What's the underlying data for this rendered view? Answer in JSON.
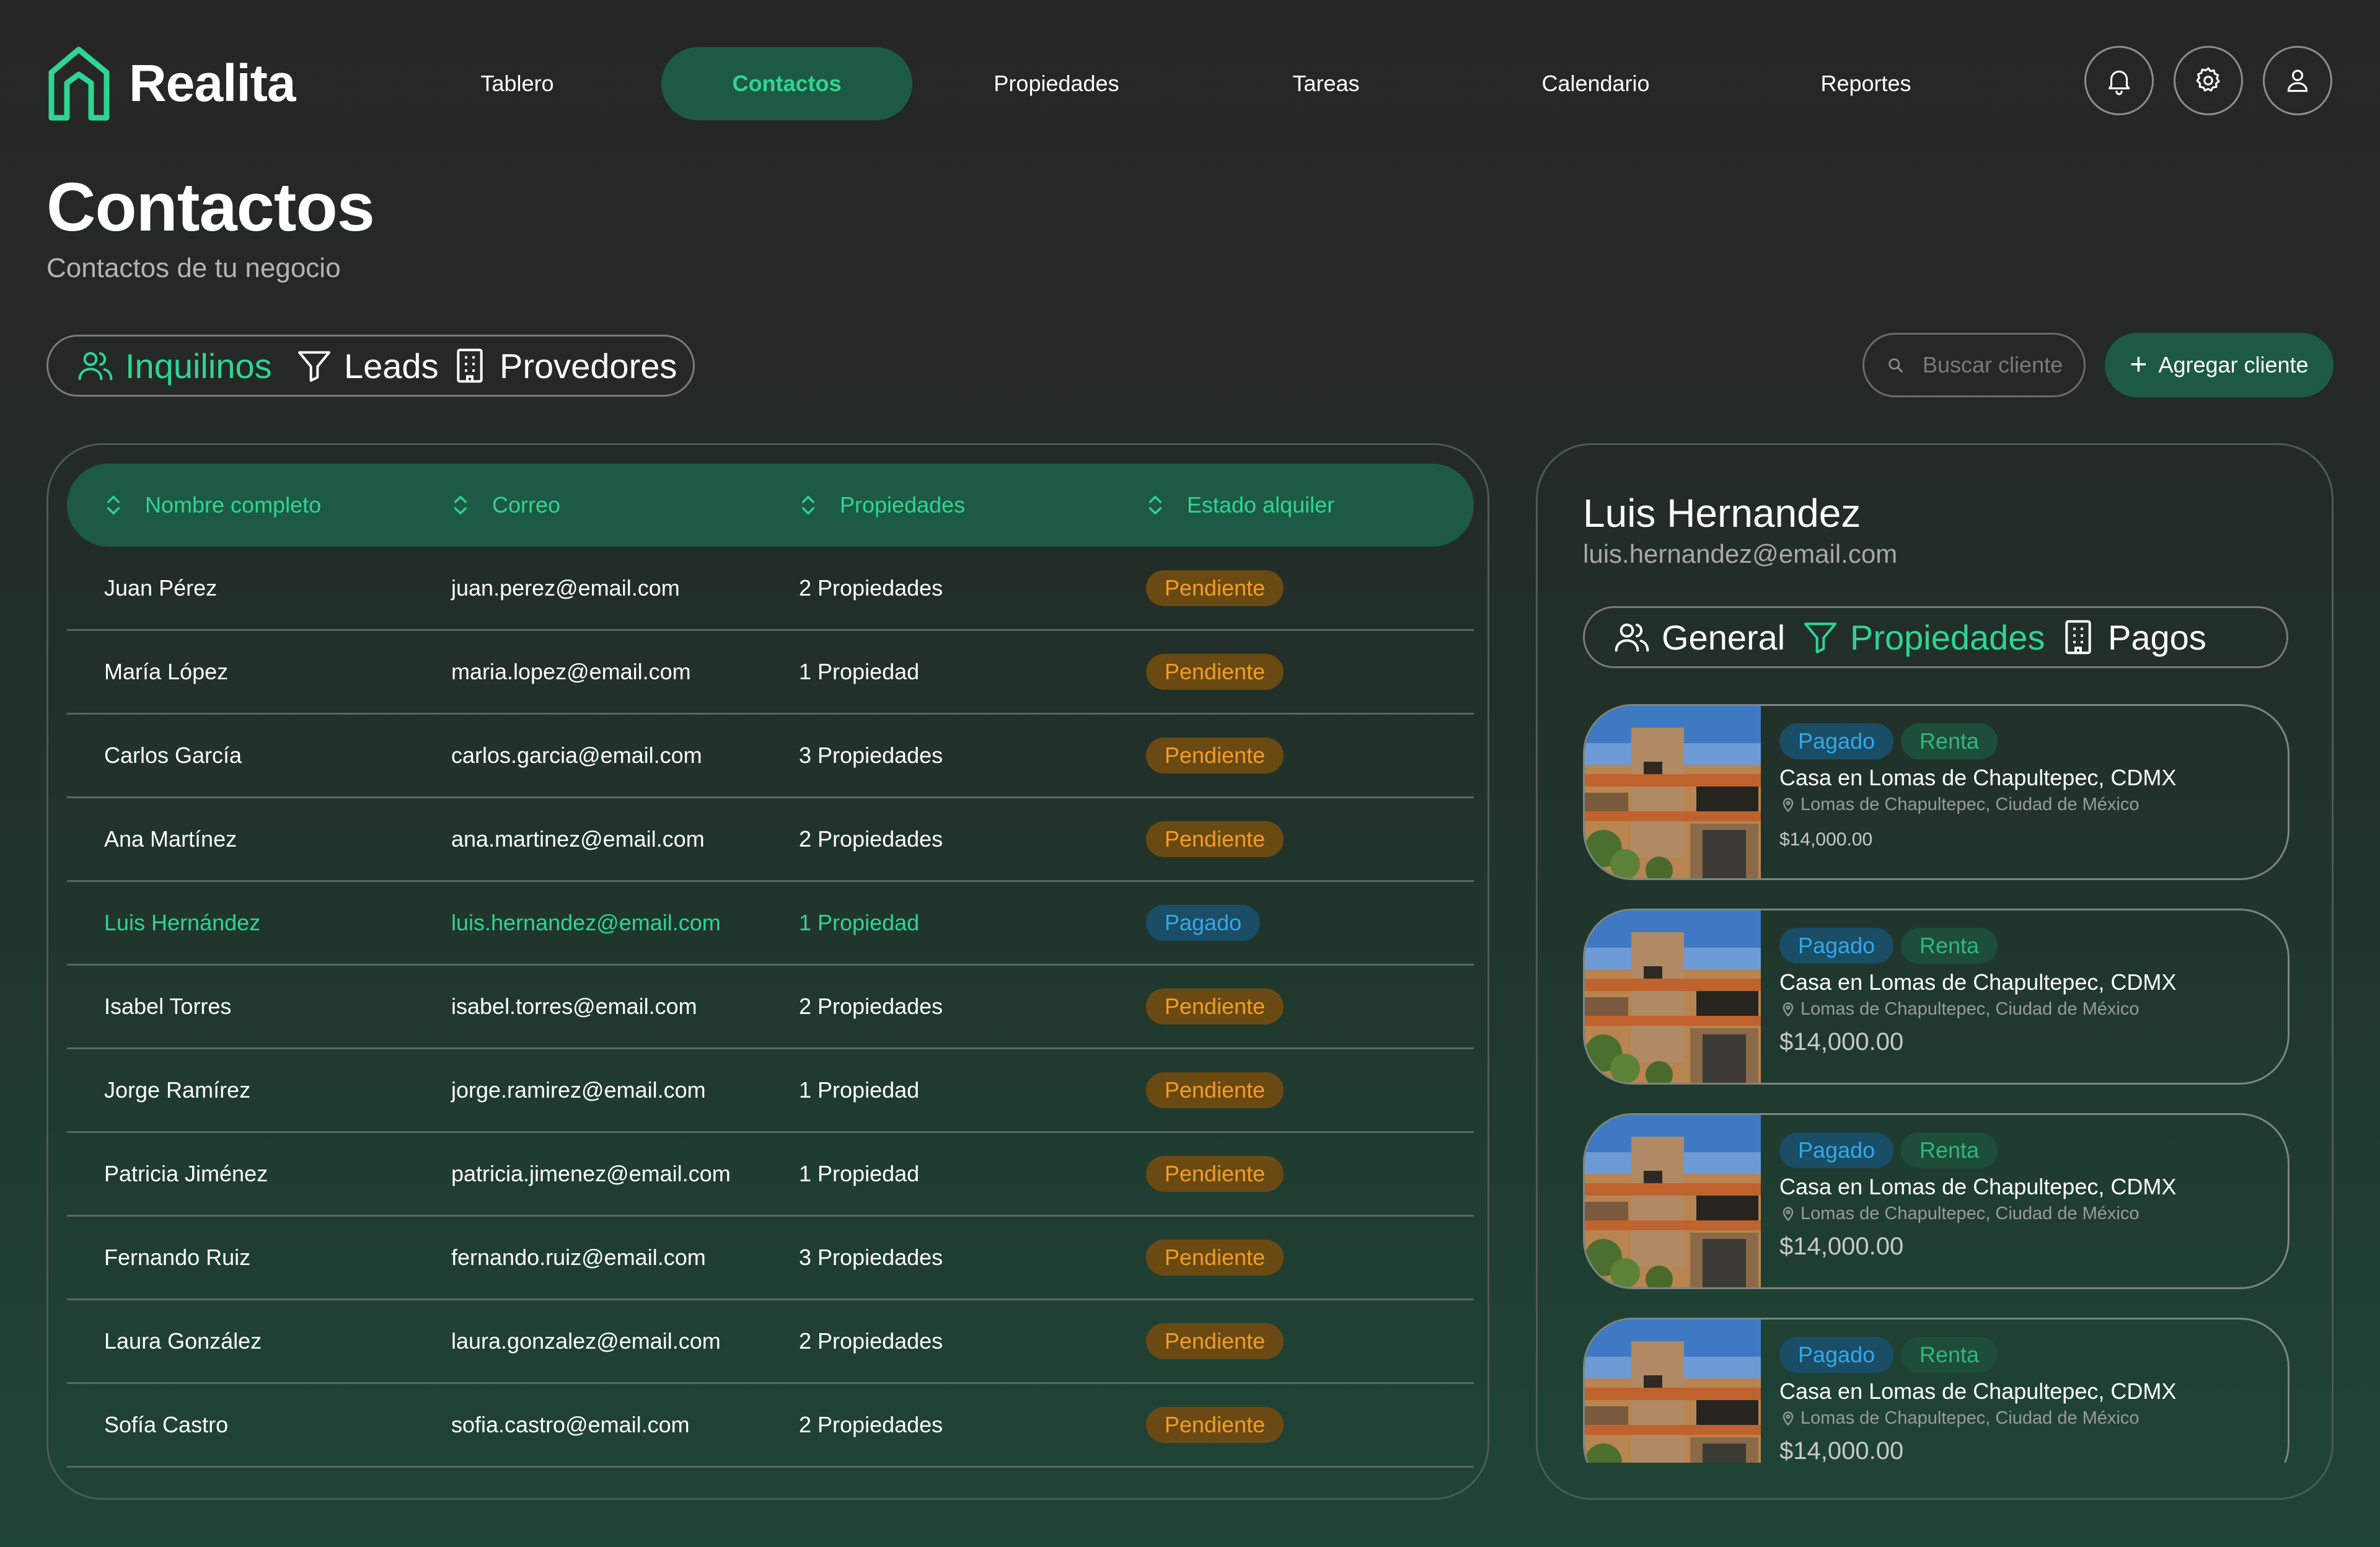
{
  "app": {
    "brand": "Realita"
  },
  "nav": {
    "items": [
      {
        "label": "Tablero",
        "active": false
      },
      {
        "label": "Contactos",
        "active": true
      },
      {
        "label": "Propiedades",
        "active": false
      },
      {
        "label": "Tareas",
        "active": false
      },
      {
        "label": "Calendario",
        "active": false
      },
      {
        "label": "Reportes",
        "active": false
      }
    ],
    "icons": [
      "bell-icon",
      "gear-icon",
      "user-icon"
    ]
  },
  "header": {
    "title": "Contactos",
    "subtitle": "Contactos de tu negocio"
  },
  "filters": {
    "tabs": [
      {
        "label": "Inquilinos",
        "icon": "users-icon",
        "active": true
      },
      {
        "label": "Leads",
        "icon": "filter-icon",
        "active": false
      },
      {
        "label": "Provedores",
        "icon": "building-icon",
        "active": false
      }
    ]
  },
  "search": {
    "placeholder": "Buscar cliente"
  },
  "add_button": {
    "label": "Agregar cliente"
  },
  "table": {
    "columns": [
      "Nombre completo",
      "Correo",
      "Propiedades",
      "Estado alquiler"
    ],
    "rows": [
      {
        "name": "Juan Pérez",
        "email": "juan.perez@email.com",
        "properties": "2 Propiedades",
        "status": "Pendiente"
      },
      {
        "name": "María López",
        "email": "maria.lopez@email.com",
        "properties": "1 Propiedad",
        "status": "Pendiente"
      },
      {
        "name": "Carlos García",
        "email": "carlos.garcia@email.com",
        "properties": "3 Propiedades",
        "status": "Pendiente"
      },
      {
        "name": "Ana Martínez",
        "email": "ana.martinez@email.com",
        "properties": "2 Propiedades",
        "status": "Pendiente"
      },
      {
        "name": "Luis Hernández",
        "email": "luis.hernandez@email.com",
        "properties": "1 Propiedad",
        "status": "Pagado"
      },
      {
        "name": "Isabel Torres",
        "email": "isabel.torres@email.com",
        "properties": "2 Propiedades",
        "status": "Pendiente"
      },
      {
        "name": "Jorge Ramírez",
        "email": "jorge.ramirez@email.com",
        "properties": "1 Propiedad",
        "status": "Pendiente"
      },
      {
        "name": "Patricia Jiménez",
        "email": "patricia.jimenez@email.com",
        "properties": "1 Propiedad",
        "status": "Pendiente"
      },
      {
        "name": "Fernando Ruiz",
        "email": "fernando.ruiz@email.com",
        "properties": "3 Propiedades",
        "status": "Pendiente"
      },
      {
        "name": "Laura González",
        "email": "laura.gonzalez@email.com",
        "properties": "2 Propiedades",
        "status": "Pendiente"
      },
      {
        "name": "Sofía Castro",
        "email": "sofia.castro@email.com",
        "properties": "2 Propiedades",
        "status": "Pendiente"
      }
    ]
  },
  "detail": {
    "name": "Luis Hernandez",
    "email": "luis.hernandez@email.com",
    "tabs": [
      {
        "label": "General",
        "icon": "users-icon",
        "active": false
      },
      {
        "label": "Propiedades",
        "icon": "filter-icon",
        "active": true
      },
      {
        "label": "Pagos",
        "icon": "building-icon",
        "active": false
      }
    ],
    "properties": [
      {
        "status": "Pagado",
        "type": "Renta",
        "title": "Casa en Lomas de Chapultepec, CDMX",
        "location": "Lomas de Chapultepec, Ciudad de México",
        "price": "$14,000.00"
      },
      {
        "status": "Pagado",
        "type": "Renta",
        "title": "Casa en Lomas de Chapultepec, CDMX",
        "location": "Lomas de Chapultepec, Ciudad de México",
        "price": "$14,000.00"
      },
      {
        "status": "Pagado",
        "type": "Renta",
        "title": "Casa en Lomas de Chapultepec, CDMX",
        "location": "Lomas de Chapultepec, Ciudad de México",
        "price": "$14,000.00"
      },
      {
        "status": "Pagado",
        "type": "Renta",
        "title": "Casa en Lomas de Chapultepec, CDMX",
        "location": "Lomas de Chapultepec, Ciudad de México",
        "price": "$14,000.00"
      }
    ]
  },
  "colors": {
    "accent": "#2fd592",
    "accent_bg": "#1d5a45",
    "pending": "#f39c24",
    "paid": "#35a7e6"
  }
}
